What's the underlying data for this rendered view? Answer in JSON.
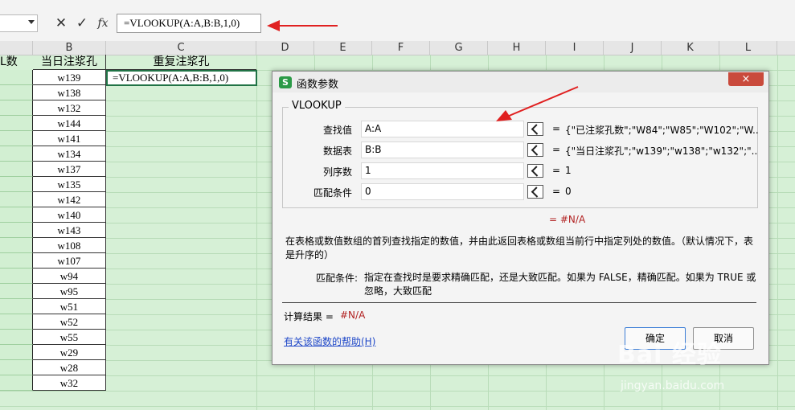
{
  "formula_bar": {
    "cancel_icon": "x-icon",
    "confirm_icon": "check-icon",
    "fx_label": "fx",
    "formula": "=VLOOKUP(A:A,B:B,1,0)"
  },
  "columns": [
    "B",
    "C",
    "D",
    "E",
    "F",
    "G",
    "H",
    "I",
    "J",
    "K",
    "L"
  ],
  "sheet": {
    "header_a": "L数",
    "header_b": "当日注浆孔",
    "header_c": "重复注浆孔",
    "active_cell": "=VLOOKUP(A:A,B:B,1,0)",
    "col_b_values": [
      "w139",
      "w138",
      "w132",
      "w144",
      "w141",
      "w134",
      "w137",
      "w135",
      "w142",
      "w140",
      "w143",
      "w108",
      "w107",
      "w94",
      "w95",
      "w51",
      "w52",
      "w55",
      "w29",
      "w28",
      "w32"
    ]
  },
  "dialog": {
    "title": "函数参数",
    "close": "×",
    "function_name": "VLOOKUP",
    "args": [
      {
        "label": "查找值",
        "value": "A:A",
        "result": "{\"已注浆孔数\";\"W84\";\"W85\";\"W102\";\"W..."
      },
      {
        "label": "数据表",
        "value": "B:B",
        "result": "{\"当日注浆孔\";\"w139\";\"w138\";\"w132\";\"..."
      },
      {
        "label": "列序数",
        "value": "1",
        "result": "1"
      },
      {
        "label": "匹配条件",
        "value": "0",
        "result": "0"
      }
    ],
    "eq": "=",
    "result_mid": "= #N/A",
    "description": "在表格或数值数组的首列查找指定的数值，并由此返回表格或数组当前行中指定列处的数值。（默认情况下，表是升序的）",
    "param_label": "匹配条件:",
    "param_desc": "指定在查找时是要求精确匹配，还是大致匹配。如果为 FALSE，精确匹配。如果为 TRUE 或忽略，大致匹配",
    "calc_label": "计算结果 =",
    "calc_value": "#N/A",
    "help_link": "有关该函数的帮助(H)",
    "ok": "确定",
    "cancel": "取消"
  },
  "watermark": {
    "brand": "Bai 经验",
    "sub": "jingyan.baidu.com"
  },
  "colors": {
    "grid_bg": "#d6f0d6",
    "accent_green": "#217346",
    "arrow_red": "#e02020",
    "error_red": "#b22222"
  }
}
